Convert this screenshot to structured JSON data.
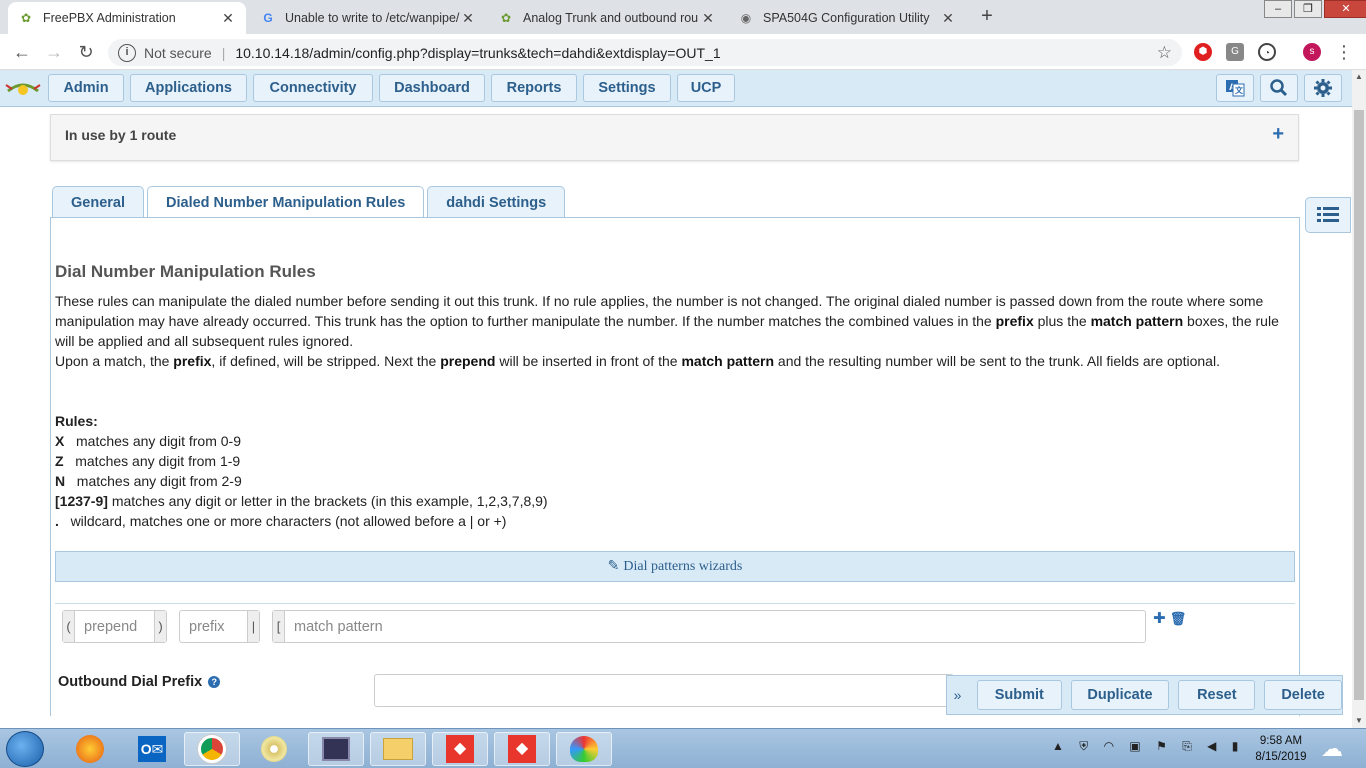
{
  "browser": {
    "tabs": [
      {
        "title": "FreePBX Administration",
        "active": true
      },
      {
        "title": "Unable to write to /etc/wanpipe/",
        "active": false
      },
      {
        "title": "Analog Trunk and outbound rou",
        "active": false
      },
      {
        "title": "SPA504G Configuration Utility",
        "active": false
      }
    ],
    "not_secure": "Not secure",
    "url": "10.10.14.18/admin/config.php?display=trunks&tech=dahdi&extdisplay=OUT_1",
    "profile_initial": "s"
  },
  "topnav": {
    "items": [
      "Admin",
      "Applications",
      "Connectivity",
      "Dashboard",
      "Reports",
      "Settings",
      "UCP"
    ]
  },
  "inuse": {
    "label": "In use by 1 route"
  },
  "tabs": [
    "General",
    "Dialed Number Manipulation Rules",
    "dahdi Settings"
  ],
  "section": {
    "title": "Dial Number Manipulation Rules",
    "p1_a": "These rules can manipulate the dialed number before sending it out this trunk. If no rule applies, the number is not changed. The original dialed number is passed down from the route where some manipulation may have already occurred. This trunk has the option to further manipulate the number. If the number matches the combined values in the ",
    "p1_b": "prefix",
    "p1_c": " plus the ",
    "p1_d": "match pattern",
    "p1_e": " boxes, the rule will be applied and all subsequent rules ignored.",
    "p2_a": "Upon a match, the ",
    "p2_b": "prefix",
    "p2_c": ", if defined, will be stripped. Next the ",
    "p2_d": "prepend",
    "p2_e": " will be inserted in front of the ",
    "p2_f": "match pattern",
    "p2_g": " and the resulting number will be sent to the trunk. All fields are optional.",
    "rules_title": "Rules:",
    "rules": [
      {
        "key": "X",
        "text": "matches any digit from 0-9"
      },
      {
        "key": "Z",
        "text": "matches any digit from 1-9"
      },
      {
        "key": "N",
        "text": "matches any digit from 2-9"
      },
      {
        "key": "[1237-9]",
        "text": "matches any digit or letter in the brackets (in this example, 1,2,3,7,8,9)"
      },
      {
        "key": ".",
        "text": "wildcard, matches one or more characters (not allowed before a | or +)"
      }
    ]
  },
  "wizard": {
    "label": "Dial patterns wizards"
  },
  "pattern": {
    "prepend_placeholder": "prepend",
    "prefix_placeholder": "prefix",
    "match_placeholder": "match pattern",
    "open_paren": "(",
    "close_paren": ")",
    "pipe": "|",
    "bracket": "["
  },
  "outbound": {
    "label": "Outbound Dial Prefix",
    "value": ""
  },
  "actions": [
    "Submit",
    "Duplicate",
    "Reset",
    "Delete"
  ],
  "taskbar": {
    "time": "9:58 AM",
    "date": "8/15/2019"
  }
}
